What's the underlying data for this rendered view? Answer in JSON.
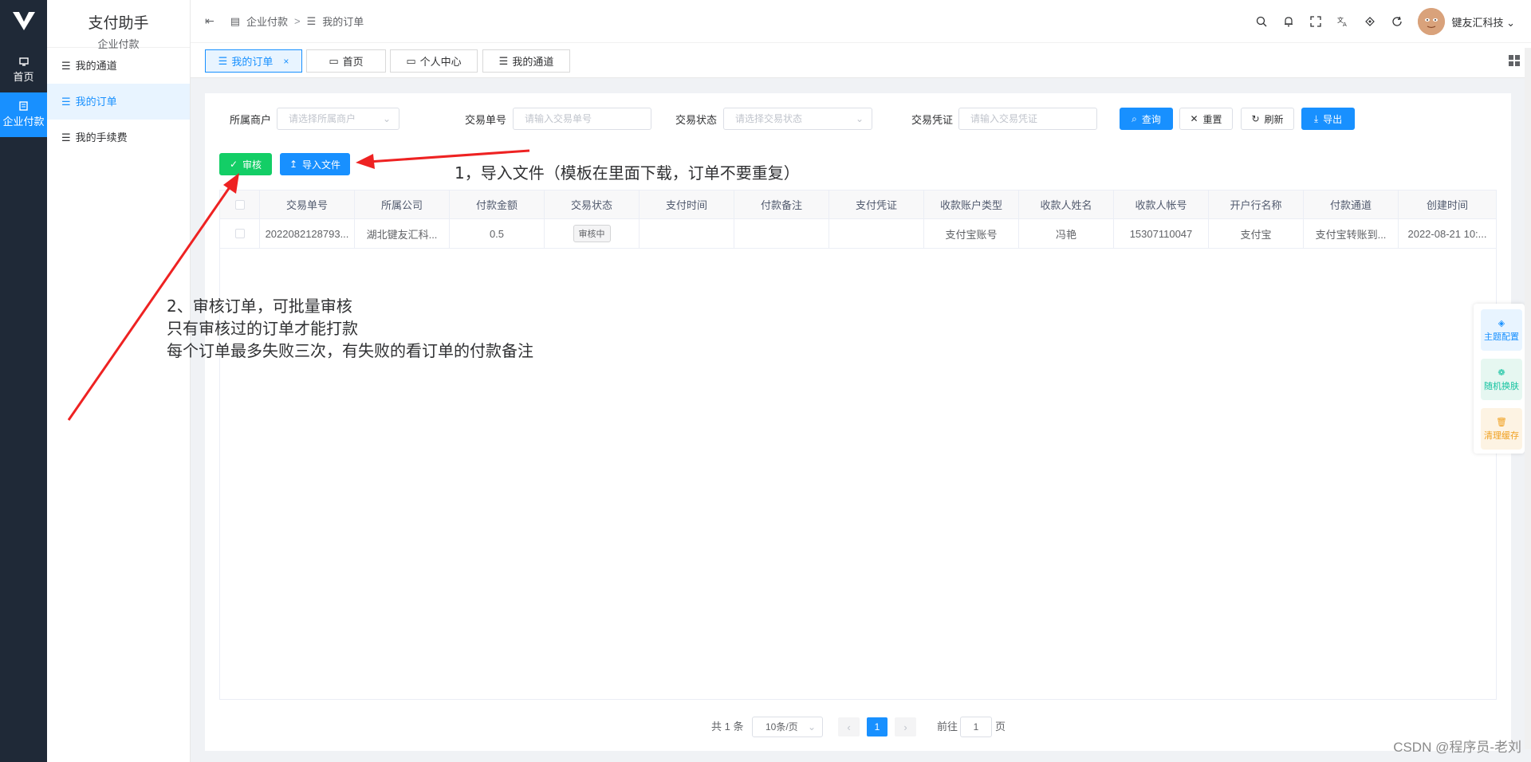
{
  "nav": {
    "items": [
      {
        "label": "首页",
        "icon": "monitor-icon"
      },
      {
        "label": "企业付款",
        "icon": "document-icon"
      }
    ]
  },
  "submenu": {
    "title": "支付助手",
    "subtitle": "企业付款",
    "items": [
      {
        "label": "我的通道"
      },
      {
        "label": "我的订单"
      },
      {
        "label": "我的手续费"
      }
    ]
  },
  "header": {
    "breadcrumb": [
      "企业付款",
      "我的订单"
    ],
    "separator": ">",
    "username": "键友汇科技"
  },
  "tabs": [
    {
      "label": "我的订单",
      "close": "×"
    },
    {
      "label": "首页"
    },
    {
      "label": "个人中心"
    },
    {
      "label": "我的通道"
    }
  ],
  "filters": {
    "merchant": {
      "label": "所属商户",
      "placeholder": "请选择所属商户"
    },
    "order_no": {
      "label": "交易单号",
      "placeholder": "请输入交易单号"
    },
    "status": {
      "label": "交易状态",
      "placeholder": "请选择交易状态"
    },
    "voucher": {
      "label": "交易凭证",
      "placeholder": "请输入交易凭证"
    },
    "buttons": {
      "search": "查询",
      "reset": "重置",
      "refresh": "刷新",
      "export": "导出"
    }
  },
  "actions": {
    "audit": "审核",
    "import": "导入文件"
  },
  "table": {
    "columns": [
      "交易单号",
      "所属公司",
      "付款金额",
      "交易状态",
      "支付时间",
      "付款备注",
      "支付凭证",
      "收款账户类型",
      "收款人姓名",
      "收款人帐号",
      "开户行名称",
      "付款通道",
      "创建时间"
    ],
    "rows": [
      [
        "2022082128793...",
        "湖北键友汇科...",
        "0.5",
        "审核中",
        "",
        "",
        "",
        "支付宝账号",
        "冯艳",
        "15307110047",
        "支付宝",
        "支付宝转账到...",
        "2022-08-21 10:..."
      ]
    ]
  },
  "pagination": {
    "total": "共 1 条",
    "page_size": "10条/页",
    "current_page": "1",
    "goto_prefix": "前往",
    "goto_value": "1",
    "goto_suffix": "页"
  },
  "float_panel": {
    "theme": "主题配置",
    "random": "随机换肤",
    "clear": "清理缓存"
  },
  "annotations": {
    "note1": "1，导入文件（模板在里面下载，订单不要重复）",
    "note2_line1": "2、审核订单，可批量审核",
    "note2_line2": "只有审核过的订单才能打款",
    "note2_line3": "每个订单最多失败三次，有失败的看订单的付款备注"
  },
  "watermark": "CSDN @程序员-老刘",
  "colors": {
    "primary": "#1890ff",
    "success": "#13ce66",
    "nav_bg": "#1f2937",
    "annotation_arrow": "#ee2222"
  }
}
